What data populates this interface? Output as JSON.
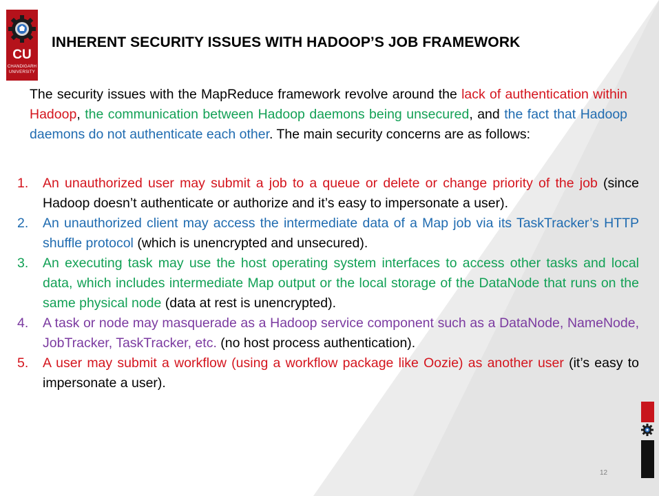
{
  "logo": {
    "text": "CU",
    "line1": "CHANDIGARH",
    "line2": "UNIVERSITY",
    "icon": "gear-emblem-icon"
  },
  "title": "INHERENT SECURITY ISSUES WITH HADOOP’S JOB FRAMEWORK",
  "intro": {
    "a": "The security issues with the MapReduce framework revolve around the ",
    "b": "lack of authentication within Hadoop",
    "c": ", ",
    "d": "the communication between Hadoop daemons being unsecured",
    "e": ", and ",
    "f": "the fact that Hadoop daemons do not authenticate each other",
    "g": ". The main security concerns are as follows:"
  },
  "items": [
    {
      "num": "1.",
      "main": "An unauthorized user may submit a job to a queue or delete or change priority of the job",
      "rest": " (since Hadoop doesn’t authenticate or authorize and it’s easy to impersonate a user)."
    },
    {
      "num": "2.",
      "main": "An unauthorized client may access the intermediate data of a Map job via its TaskTracker’s HTTP shuffle protocol",
      "rest": " (which is unencrypted and unsecured)."
    },
    {
      "num": "3.",
      "main": "An executing task may use the host operating system interfaces to access other tasks and local data, which includes intermediate Map output or the local storage of the DataNode that runs on the same physical node",
      "rest": " (data at rest is unencrypted)."
    },
    {
      "num": "4.",
      "main": "A task or node may masquerade as a Hadoop service component such as a DataNode, NameNode, JobTracker, TaskTracker, etc.",
      "rest": " (no host process authentication)."
    },
    {
      "num": "5.",
      "main": "A user may submit a workflow (using a workflow package like Oozie) as another user",
      "rest": " (it’s easy to impersonate a user)."
    }
  ],
  "page_number": "12",
  "colors": {
    "red": "#d4141d",
    "green": "#12a055",
    "blue": "#1f6bb0",
    "purple": "#7b3aa0",
    "brand_red": "#b5121b"
  }
}
